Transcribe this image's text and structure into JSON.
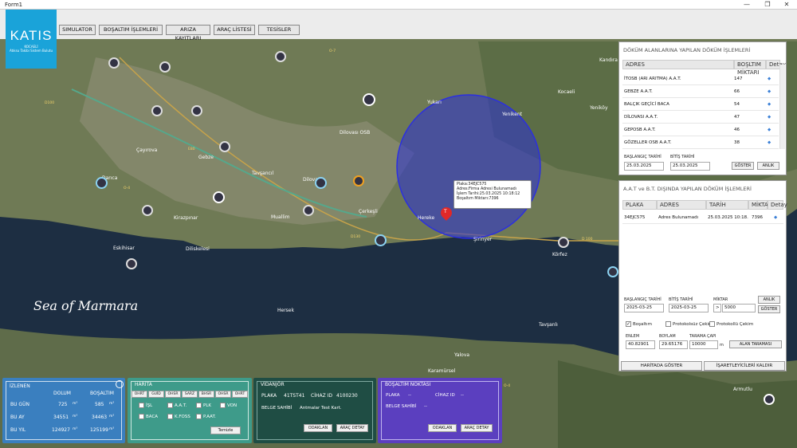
{
  "window": {
    "title": "Form1",
    "min": "—",
    "max": "❐",
    "close": "✕"
  },
  "logo": {
    "name": "KATIS",
    "sub": "KOCAELİ\nAtıksu Takibi Sistem Bulutu"
  },
  "nav": [
    "SIMULATOR",
    "BOŞALTIM İŞLEMLERİ",
    "ARIZA KAYITLARI",
    "ARAÇ LİSTESİ",
    "TESİSLER"
  ],
  "map": {
    "sea": "Sea of Marmara",
    "places": [
      "Gebze",
      "Darıca",
      "Çayırova",
      "Dilovası",
      "Körfez",
      "Hersek",
      "Yalova",
      "Kocaeli",
      "Kandıra",
      "Hereke",
      "Yeniköy",
      "Karamürsel",
      "Diliskelesi",
      "Çerkeşli",
      "Tavşancıl",
      "Muallim",
      "Eskihisar",
      "Dilovası OSB",
      "Kirazpınar",
      "Yukarı",
      "Şirinyer",
      "Armutlu",
      "Tavşanlı",
      "Yenikent"
    ],
    "tooltip": [
      "Plaka:34EJC575",
      "Adres:Firma Adresi Bulunamadı",
      "İşlem Tarihi:25.03.2025 10:18:12",
      "Boşaltım Miktarı:7396"
    ],
    "marker": "T",
    "road_labels": [
      "D100",
      "O-4",
      "E80",
      "D130",
      "O-7",
      "D 100",
      "O-4"
    ]
  },
  "dump_panel": {
    "title": "DÖKÜM ALANLARINA YAPILAN DÖKÜM İŞLEMLERİ",
    "headers": [
      "ADRES",
      "BOŞLTIM MİKTARI",
      "Detay"
    ],
    "rows": [
      [
        "İTOSB (ARI ARITMA) A.A.T.",
        "147"
      ],
      [
        "GEBZE A.A.T.",
        "66"
      ],
      [
        "BALÇIK GEÇİCİ BACA",
        "54"
      ],
      [
        "DİLOVASI A.A.T.",
        "47"
      ],
      [
        "GEPOSB A.A.T.",
        "46"
      ],
      [
        "GÖZELLER OSB A.A.T.",
        "38"
      ]
    ],
    "start_label": "BAŞLANGIÇ TARİHİ",
    "end_label": "BİTİŞ TARİHİ",
    "start": "25.03.2025",
    "end": "25.03.2025",
    "show": "GÖSTER",
    "now": "ANLIK"
  },
  "aat_panel": {
    "title": "A.A.T ve B.T. DIŞINDA YAPILAN DÖKÜM İŞLEMLERİ",
    "headers": [
      "PLAKA",
      "ADRES",
      "TARİH",
      "MİKTAR",
      "Detay"
    ],
    "rows": [
      [
        "34EJC575",
        "Adres Bulunamadı",
        "25.03.2025 10:18.",
        "7396"
      ]
    ],
    "start_label": "BAŞLANGIÇ TARİHİ",
    "end_label": "BİTİŞ TARİHİ",
    "amount_label": "MİKTAR",
    "start": "2025-03-25",
    "end": "2025-03-25",
    "op": ">",
    "amount": "5000",
    "now": "ANLIK",
    "show": "GÖSTER",
    "checks": [
      "Boşaltım",
      "Protokolsüz Çekim",
      "Protokollü Çekim"
    ],
    "lat_label": "ENLEM",
    "lon_label": "BOYLAM",
    "radius_label": "TARAMA ÇAPI",
    "lat": "40.82901",
    "lon": "29.65176",
    "radius": "10000",
    "unit": "m",
    "scan": "ALAN TARAMASI",
    "show_map": "HARİTADA GÖSTER",
    "clear": "İŞARETLEYİCİLERİ KALDIR"
  },
  "izlenen": {
    "title": "İZLENEN",
    "col1": "DOLUM",
    "col2": "BOŞALTIM",
    "rows": [
      [
        "BU GÜN",
        "725",
        "585"
      ],
      [
        "BU AY",
        "34551",
        "34463"
      ],
      [
        "BU YIL",
        "124927",
        "125199"
      ]
    ],
    "unit": "m³"
  },
  "harita": {
    "title": "HARİTA",
    "tabs": [
      "OHRT",
      "GUİD",
      "OHSR",
      "SARZ",
      "BHSR",
      "OHSR",
      "OHRT"
    ],
    "checks": [
      [
        "İŞL",
        false
      ],
      [
        "A.A.T.",
        true
      ],
      [
        "PLK",
        false
      ],
      [
        "VON",
        true
      ],
      [
        "BACA",
        false
      ],
      [
        "K.FOSS",
        false
      ],
      [
        "P.AAT.",
        false
      ]
    ],
    "clear": "Temizle"
  },
  "vidanjor": {
    "title": "VİDANJÖR",
    "plaka_label": "PLAKA",
    "plaka": "41TST41",
    "cihaz_label": "CİHAZ ID",
    "cihaz": "4100230",
    "belge_label": "BELGE SAHİBİ",
    "belge": "Antmalar Test Kart.",
    "focus": "ODAKLAN",
    "detail": "ARAÇ DETAY"
  },
  "bosaltim": {
    "title": "BOŞALTIM NOKTASI",
    "plaka_label": "PLAKA",
    "plaka": "--",
    "cihaz_label": "CİHAZ ID",
    "cihaz": "--",
    "belge_label": "BELGE SAHİBİ",
    "belge": "--",
    "focus": "ODAKLAN",
    "detail": "ARAÇ DETAY"
  },
  "colors": {
    "accent": "#1aa3d9",
    "izlenen": "#3a7fbf",
    "harita": "#3e9b8a",
    "vidanjor": "#1f4d44",
    "bosaltim": "#5b3fbf",
    "circle": "#2a2fd6",
    "marker": "#e02828"
  }
}
